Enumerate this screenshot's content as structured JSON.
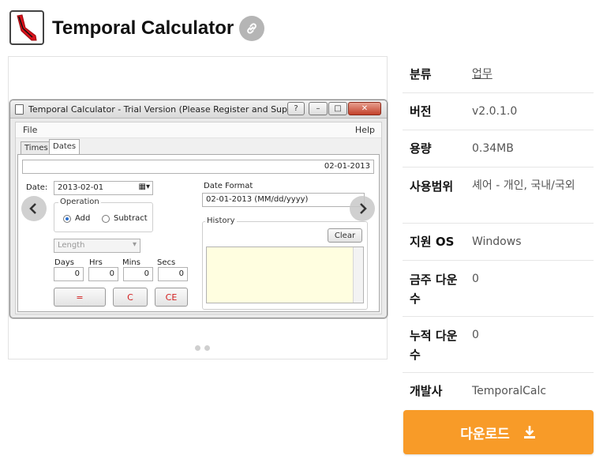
{
  "header": {
    "app_title": "Temporal Calculator",
    "icon": "temporal-calculator-logo",
    "link_icon": "link-icon"
  },
  "gallery": {
    "screenshot": {
      "window_title": "Temporal Calculator - Trial Version (Please Register and Support Us)",
      "menu": {
        "file": "File",
        "help": "Help"
      },
      "tabs": [
        {
          "label": "Times",
          "active": false
        },
        {
          "label": "Dates",
          "active": true
        }
      ],
      "result_value": "02-01-2013",
      "date_label": "Date:",
      "date_value": "2013-02-01",
      "operation_title": "Operation",
      "operation_add": "Add",
      "operation_subtract": "Subtract",
      "unit_select": "Length",
      "fields": [
        {
          "label": "Days",
          "value": "0"
        },
        {
          "label": "Hrs",
          "value": "0"
        },
        {
          "label": "Mins",
          "value": "0"
        },
        {
          "label": "Secs",
          "value": "0"
        }
      ],
      "buttons": {
        "equals": "=",
        "clear": "C",
        "clear_entry": "CE"
      },
      "date_format_title": "Date Format",
      "date_format_value": "02-01-2013 (MM/dd/yyyy)",
      "history_title": "History",
      "history_clear": "Clear"
    },
    "prev_icon": "chevron-left-icon",
    "next_icon": "chevron-right-icon",
    "slide_count": 2
  },
  "info": [
    {
      "key": "분류",
      "value": "업무",
      "link": true
    },
    {
      "key": "버전",
      "value": "v2.0.1.0",
      "link": false
    },
    {
      "key": "용량",
      "value": "0.34MB",
      "link": false
    },
    {
      "key": "사용범위",
      "value": "셰어 - 개인, 국내/국외",
      "link": false
    },
    {
      "key": "지원 OS",
      "value": "Windows",
      "link": false
    },
    {
      "key": "금주 다운수",
      "value": "0",
      "link": false
    },
    {
      "key": "누적 다운수",
      "value": "0",
      "link": false
    },
    {
      "key": "개발사",
      "value": "TemporalCalc",
      "link": false
    }
  ],
  "download": {
    "label": "다운로드",
    "icon": "download-icon"
  },
  "colors": {
    "download_button": "#f89b28",
    "link_button": "#b5b5b5"
  }
}
